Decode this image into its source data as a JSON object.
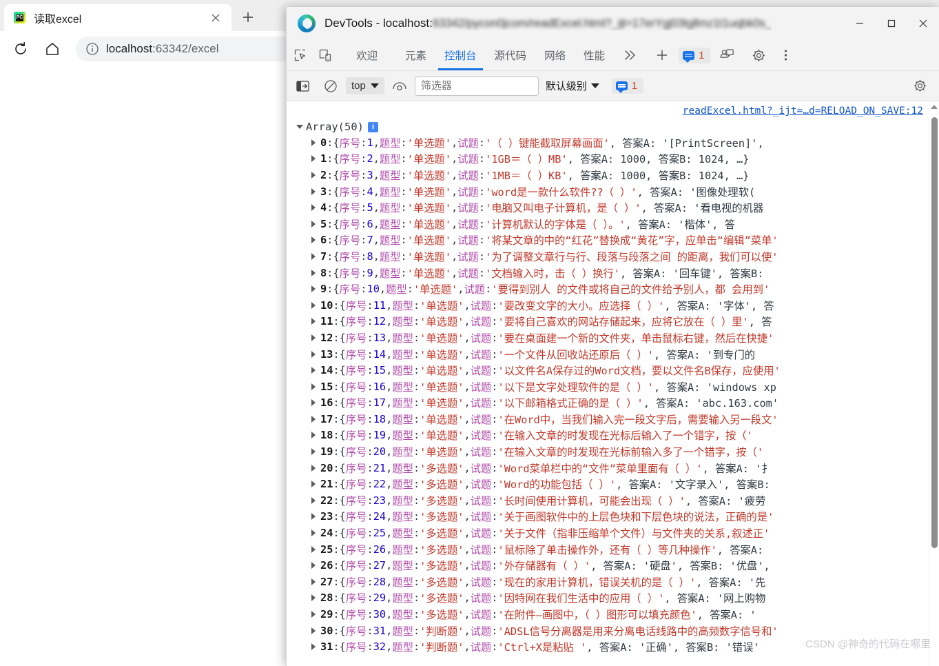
{
  "browser": {
    "tab": {
      "title": "读取excel",
      "favicon": "pycharm-icon",
      "close_label": "×"
    },
    "new_tab_label": "+",
    "toolbar": {
      "reload_label": "reload-icon",
      "home_label": "home-icon",
      "url_host": "localhost",
      "url_rest": ":63342/excel",
      "info_icon": "info-circle-icon"
    }
  },
  "devtools": {
    "window_title_prefix": "DevTools - localhost:",
    "window_title_blurred": "63342/pycon0jcom/readExcel.html?_ijt=17erYgj03tgllmz1t1uqbk0s_",
    "window_controls": {
      "minimize": "—",
      "maximize": "☐",
      "close": "✕"
    },
    "tabs": [
      {
        "label": "欢迎",
        "active": false
      },
      {
        "label": "元素",
        "active": false
      },
      {
        "label": "控制台",
        "active": true
      },
      {
        "label": "源代码",
        "active": false
      },
      {
        "label": "网络",
        "active": false
      },
      {
        "label": "性能",
        "active": false
      }
    ],
    "more_tabs_label": "»",
    "add_tab_label": "+",
    "issues_count": "1",
    "toolbar_icons": {
      "inspect": "inspect-element-icon",
      "device": "device-toolbar-icon",
      "feedback": "feedback-icon",
      "settings": "gear-icon",
      "more": "kebab-menu-icon"
    },
    "console_toolbar": {
      "sidebar_toggle": "console-sidebar-icon",
      "clear_label": "clear-console-icon",
      "context": "top",
      "live_expression": "eye-icon",
      "filter_placeholder": "筛选器",
      "filter_value": "",
      "levels": "默认级别",
      "issues_count": "1",
      "settings": "gear-icon"
    }
  },
  "console": {
    "source_link": "readExcel.html?_ijt=…d=RELOAD_ON_SAVE:12",
    "array_header": "Array(50)",
    "info_badge": "i",
    "keys": {
      "seq": "序号",
      "type": "题型",
      "question": "试题",
      "ansA": "答案A",
      "ansB": "答案B"
    },
    "rows": [
      {
        "idx": "0",
        "seq": "1",
        "type": "单选题",
        "q": "（  ）键能截取屏幕画面",
        "tail": ", 答案A: '[PrintScreen]', "
      },
      {
        "idx": "1",
        "seq": "2",
        "type": "单选题",
        "q": "1GB＝（    ）MB",
        "tail": ", 答案A: 1000, 答案B: 1024, …}"
      },
      {
        "idx": "2",
        "seq": "3",
        "type": "单选题",
        "q": "1MB＝（    ）KB",
        "tail": ", 答案A: 1000, 答案B: 1024, …}"
      },
      {
        "idx": "3",
        "seq": "4",
        "type": "单选题",
        "q": "word是一款什么软件??（      ）",
        "tail": ", 答案A: '图像处理软("
      },
      {
        "idx": "4",
        "seq": "5",
        "type": "单选题",
        "q": "电脑又叫电子计算机，是（  ）",
        "tail": ", 答案A: '看电视的机器"
      },
      {
        "idx": "5",
        "seq": "6",
        "type": "单选题",
        "q": "计算机默认的字体是（       ）。",
        "tail": ", 答案A: '楷体', 答"
      },
      {
        "idx": "6",
        "seq": "7",
        "type": "单选题",
        "q": "将某文章的中的“红花”替换成“黄花”字，应单击“编辑”菜单",
        "tail": ""
      },
      {
        "idx": "7",
        "seq": "8",
        "type": "单选题",
        "q": "为了调整文章行与行、段落与段落之间 的距离，我们可以使",
        "tail": ""
      },
      {
        "idx": "8",
        "seq": "9",
        "type": "单选题",
        "q": "文档输入时，击（  ）换行",
        "tail": ", 答案A: '回车键', 答案B:"
      },
      {
        "idx": "9",
        "seq": "10",
        "type": "单选题",
        "q": "要得到别人 的文件或将自己的文件给予别人，都 会用到",
        "tail": ""
      },
      {
        "idx": "10",
        "seq": "11",
        "type": "单选题",
        "q": "要改变文字的大小。应选择（ ）",
        "tail": ", 答案A: '字体', 答"
      },
      {
        "idx": "11",
        "seq": "12",
        "type": "单选题",
        "q": "要将自己喜欢的网站存储起来，应将它放在（ ）里",
        "tail": ", 答"
      },
      {
        "idx": "12",
        "seq": "13",
        "type": "单选题",
        "q": "要在桌面建一个新的文件夹，单击鼠标右键，然后在快捷",
        "tail": ""
      },
      {
        "idx": "13",
        "seq": "14",
        "type": "单选题",
        "q": "一个文件从回收站还原后（    ）",
        "tail": ", 答案A: '到专门的"
      },
      {
        "idx": "14",
        "seq": "15",
        "type": "单选题",
        "q": "以文件名A保存过的Word文档，要以文件名B保存，应使用",
        "tail": ""
      },
      {
        "idx": "15",
        "seq": "16",
        "type": "单选题",
        "q": "以下是文字处理软件的是（ ）",
        "tail": ", 答案A: 'windows xp"
      },
      {
        "idx": "16",
        "seq": "17",
        "type": "单选题",
        "q": "以下邮箱格式正确的是（ ）",
        "tail": ", 答案A: 'abc.163.com'"
      },
      {
        "idx": "17",
        "seq": "18",
        "type": "单选题",
        "q": "在Word中，当我们输入完一段文字后，需要输入另一段文",
        "tail": ""
      },
      {
        "idx": "18",
        "seq": "19",
        "type": "单选题",
        "q": "在输入文章的时发现在光标后输入了一个错字，按（",
        "tail": ""
      },
      {
        "idx": "19",
        "seq": "20",
        "type": "单选题",
        "q": "在输入文章的时发现在光标前输入多了一个错字，按（",
        "tail": ""
      },
      {
        "idx": "20",
        "seq": "21",
        "type": "多选题",
        "q": "Word菜单栏中的“文件”菜单里面有（  ）",
        "tail": ", 答案A: '扌"
      },
      {
        "idx": "21",
        "seq": "22",
        "type": "多选题",
        "q": "Word的功能包括（  ）",
        "tail": ", 答案A: '文字录入', 答案B:"
      },
      {
        "idx": "22",
        "seq": "23",
        "type": "多选题",
        "q": "长时间使用计算机，可能会出现（  ）",
        "tail": ", 答案A: '疲劳"
      },
      {
        "idx": "23",
        "seq": "24",
        "type": "多选题",
        "q": "关于画图软件中的上层色块和下层色块的说法，正确的是",
        "tail": ""
      },
      {
        "idx": "24",
        "seq": "25",
        "type": "多选题",
        "q": "关于文件（指非压缩单个文件）与文件夹的关系,叙述正",
        "tail": ""
      },
      {
        "idx": "25",
        "seq": "26",
        "type": "多选题",
        "q": "鼠标除了单击操作外，还有（  ）等几种操作",
        "tail": ", 答案A:"
      },
      {
        "idx": "26",
        "seq": "27",
        "type": "多选题",
        "q": "外存储器有（  ）",
        "tail": ", 答案A: '硬盘', 答案B: '优盘',"
      },
      {
        "idx": "27",
        "seq": "28",
        "type": "多选题",
        "q": "现在的家用计算机，错误关机的是（  ）",
        "tail": ", 答案A: '先"
      },
      {
        "idx": "28",
        "seq": "29",
        "type": "多选题",
        "q": "因特网在我们生活中的应用（  ）",
        "tail": ", 答案A: '网上购物"
      },
      {
        "idx": "29",
        "seq": "30",
        "type": "多选题",
        "q": "在附件–画图中，（  ）图形可以填充颜色",
        "tail": ", 答案A: '\u0015"
      },
      {
        "idx": "30",
        "seq": "31",
        "type": "判断题",
        "q": "ADSL信号分离器是用来分离电话线路中的高频数字信号和",
        "tail": ""
      },
      {
        "idx": "31",
        "seq": "32",
        "type": "判断题",
        "q": "Ctrl+X是粘贴 ",
        "tail": ", 答案A: '正确', 答案B: '错误'"
      }
    ]
  },
  "watermark": "CSDN @神奇的代码在哪里"
}
